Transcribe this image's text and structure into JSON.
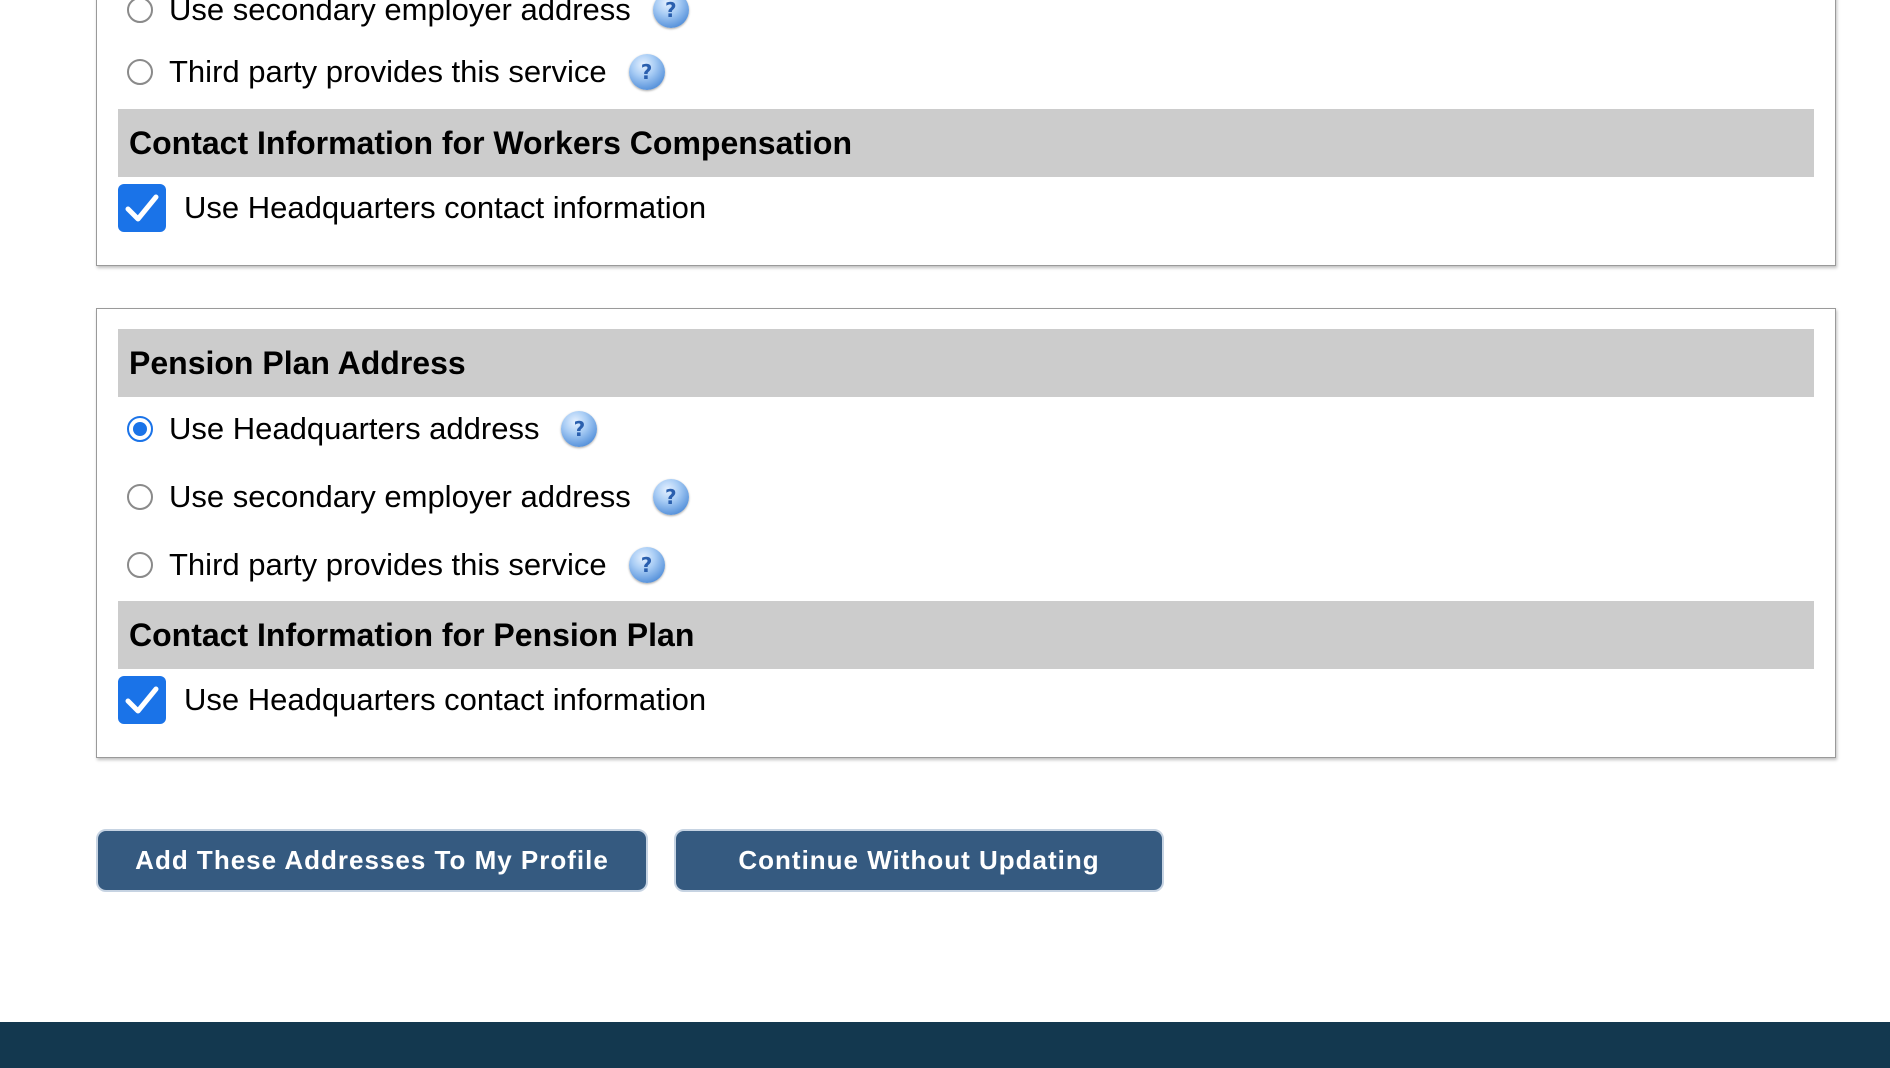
{
  "workers_comp_section": {
    "options": [
      {
        "label": "Use secondary employer address",
        "selected": false,
        "help_icon": "question-mark-icon"
      },
      {
        "label": "Third party provides this service",
        "selected": false,
        "help_icon": "question-mark-icon"
      }
    ],
    "contact_header": "Contact Information for Workers Compensation",
    "contact_checkbox_label": "Use Headquarters contact information",
    "contact_checkbox_checked": true
  },
  "pension_section": {
    "header": "Pension Plan Address",
    "options": [
      {
        "label": "Use Headquarters address",
        "selected": true,
        "help_icon": "question-mark-icon"
      },
      {
        "label": "Use secondary employer address",
        "selected": false,
        "help_icon": "question-mark-icon"
      },
      {
        "label": "Third party provides this service",
        "selected": false,
        "help_icon": "question-mark-icon"
      }
    ],
    "contact_header": "Contact Information for Pension Plan",
    "contact_checkbox_label": "Use Headquarters contact information",
    "contact_checkbox_checked": true
  },
  "actions": {
    "add_label": "Add These Addresses To My Profile",
    "continue_label": "Continue Without Updating"
  },
  "help_glyph": "?",
  "colors": {
    "accent": "#1a73e8",
    "section_header_bg": "#cccccc",
    "button_bg": "#355a80",
    "footer_bg": "#13384f"
  }
}
